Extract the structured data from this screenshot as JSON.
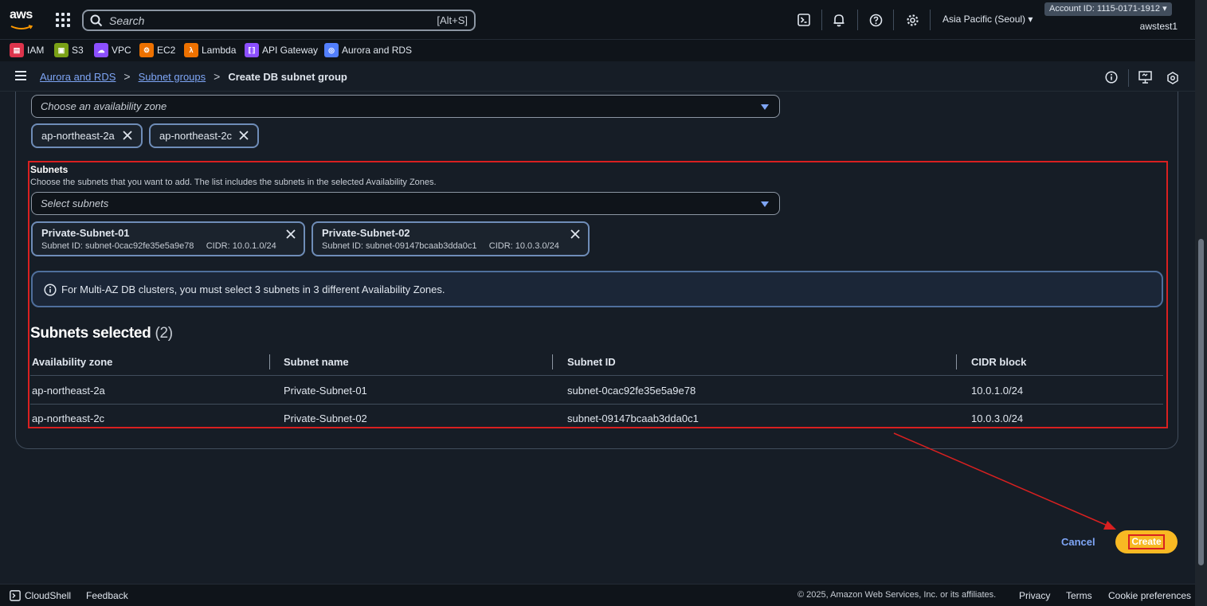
{
  "topnav": {
    "logo": "aws",
    "search_placeholder": "Search",
    "search_shortcut": "[Alt+S]",
    "region": "Asia Pacific (Seoul) ▾",
    "account_id": "Account ID: 1115-0171-1912 ▾",
    "user": "awstest1"
  },
  "favorites": [
    {
      "label": "IAM",
      "color": "#dd344c"
    },
    {
      "label": "S3",
      "color": "#7aa116"
    },
    {
      "label": "VPC",
      "color": "#8c4fff"
    },
    {
      "label": "EC2",
      "color": "#ed7100"
    },
    {
      "label": "Lambda",
      "color": "#ed7100"
    },
    {
      "label": "API Gateway",
      "color": "#8c4fff"
    },
    {
      "label": "Aurora and RDS",
      "color": "#527fff"
    }
  ],
  "breadcrumb": {
    "items": [
      "Aurora and RDS",
      "Subnet groups"
    ],
    "current": "Create DB subnet group"
  },
  "az": {
    "placeholder": "Choose an availability zone",
    "tokens": [
      "ap-northeast-2a",
      "ap-northeast-2c"
    ]
  },
  "subnets": {
    "title": "Subnets",
    "description": "Choose the subnets that you want to add. The list includes the subnets in the selected Availability Zones.",
    "placeholder": "Select subnets",
    "tokens": [
      {
        "name": "Private-Subnet-01",
        "meta": "Subnet ID: subnet-0cac92fe35e5a9e78     CIDR: 10.0.1.0/24"
      },
      {
        "name": "Private-Subnet-02",
        "meta": "Subnet ID: subnet-09147bcaab3dda0c1     CIDR: 10.0.3.0/24"
      }
    ],
    "alert": "For Multi-AZ DB clusters, you must select 3 subnets in 3 different Availability Zones."
  },
  "selected": {
    "title": "Subnets selected",
    "count": "(2)",
    "columns": [
      "Availability zone",
      "Subnet name",
      "Subnet ID",
      "CIDR block"
    ],
    "rows": [
      [
        "ap-northeast-2a",
        "Private-Subnet-01",
        "subnet-0cac92fe35e5a9e78",
        "10.0.1.0/24"
      ],
      [
        "ap-northeast-2c",
        "Private-Subnet-02",
        "subnet-09147bcaab3dda0c1",
        "10.0.3.0/24"
      ]
    ]
  },
  "actions": {
    "cancel": "Cancel",
    "create": "Create"
  },
  "footer": {
    "cloudshell": "CloudShell",
    "feedback": "Feedback",
    "copyright": "© 2025, Amazon Web Services, Inc. or its affiliates.",
    "privacy": "Privacy",
    "terms": "Terms",
    "cookies": "Cookie preferences"
  }
}
